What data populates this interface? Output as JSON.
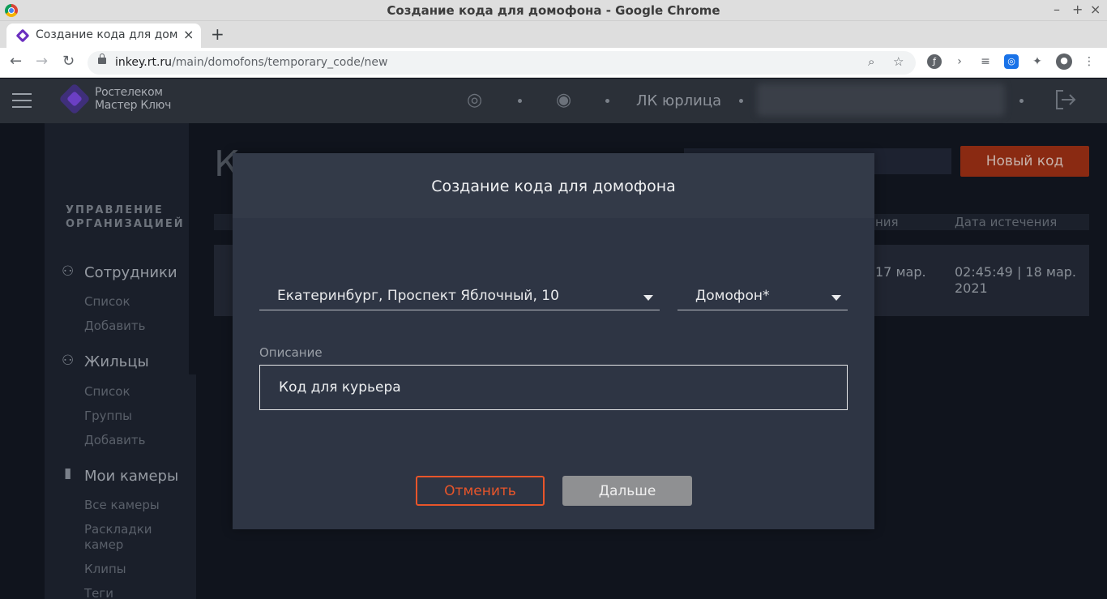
{
  "window": {
    "title": "Создание кода для домофона - Google Chrome",
    "controls": [
      "–",
      "+",
      "×"
    ]
  },
  "tab": {
    "label": "Создание кода для домофона",
    "close": "×",
    "new_tab": "+"
  },
  "address_bar": {
    "domain": "inkey.rt.ru",
    "path": "/main/domofons/temporary_code/new"
  },
  "app_header": {
    "logo_line1": "Ростелеком",
    "logo_line2": "Мастер Ключ",
    "org_label": "ЛК юрлица"
  },
  "sidebar": {
    "section_title_line1": "УПРАВЛЕНИЕ",
    "section_title_line2": "ОРГАНИЗАЦИЕЙ",
    "groups": [
      {
        "label": "Сотрудники",
        "icon": "people-icon",
        "items": [
          "Список",
          "Добавить"
        ]
      },
      {
        "label": "Жильцы",
        "icon": "people-icon",
        "items": [
          "Список",
          "Группы",
          "Добавить"
        ]
      },
      {
        "label": "Мои камеры",
        "icon": "camera-icon",
        "items": [
          "Все камеры",
          "Раскладки камер",
          "Клипы",
          "Теги"
        ]
      }
    ]
  },
  "background_page": {
    "title_fragment": "К",
    "new_code_button": "Новый код",
    "columns_visible": [
      "ния",
      "Дата истечения"
    ],
    "row": {
      "created_fragment": "17 мар.",
      "expires": "02:45:49 | 18 мар. 2021"
    }
  },
  "modal": {
    "title": "Создание кода для домофона",
    "address_select": "Екатеринбург, Проспект Яблочный, 10",
    "intercom_select": "Домофон*",
    "description_label": "Описание",
    "description_value": "Код для курьера",
    "cancel_button": "Отменить",
    "next_button": "Дальше"
  },
  "colors": {
    "accent_orange": "#e8552a",
    "new_code_bg": "#8a2a12",
    "modal_bg": "#2e3544",
    "header_bg": "#2b3038"
  }
}
